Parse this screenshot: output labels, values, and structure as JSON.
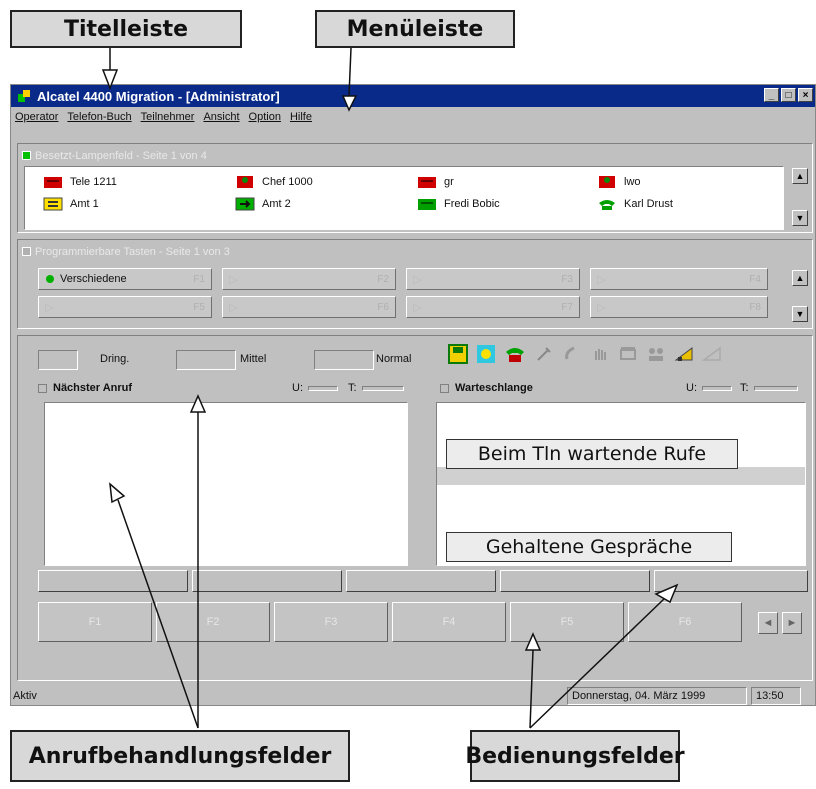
{
  "callouts": {
    "titlebar": "Titelleiste",
    "menubar": "Menüleiste",
    "call_fields": "Anrufbehandlungsfelder",
    "operator_fields": "Bedienungsfelder",
    "waiting_calls": "Beim Tln wartende Rufe",
    "held_calls": "Gehaltene Gespräche"
  },
  "window": {
    "title": "Alcatel 4400 Migration - [Administrator]",
    "buttons": [
      "_",
      "□",
      "×"
    ]
  },
  "menu": [
    "Operator",
    "Telefon-Buch",
    "Teilnehmer",
    "Ansicht",
    "Option",
    "Hilfe"
  ],
  "busy_lamp": {
    "header": "Besetzt-Lampenfeld - Seite 1 von 4",
    "parties": [
      {
        "label": "Tele 1211",
        "icon": "red-phone-icon"
      },
      {
        "label": "Chef 1000",
        "icon": "red-phone-person-icon"
      },
      {
        "label": "gr",
        "icon": "red-phone-icon"
      },
      {
        "label": "lwo",
        "icon": "red-phone-person-icon"
      },
      {
        "label": "Amt 1",
        "icon": "yellow-trunk-icon"
      },
      {
        "label": "Amt 2",
        "icon": "green-trunk-icon"
      },
      {
        "label": "Fredi Bobic",
        "icon": "green-phone-icon"
      },
      {
        "label": "Karl Drust",
        "icon": "green-handset-icon"
      }
    ]
  },
  "prog_keys": {
    "header": "Programmierbare Tasten - Seite 1 von 3",
    "keys": [
      {
        "label": "Verschiedene",
        "num": "F1"
      },
      {
        "label": "",
        "num": "F2"
      },
      {
        "label": "",
        "num": "F3"
      },
      {
        "label": "",
        "num": "F4"
      },
      {
        "label": "",
        "num": "F5"
      },
      {
        "label": "",
        "num": "F6"
      },
      {
        "label": "",
        "num": "F7"
      },
      {
        "label": "",
        "num": "F8"
      }
    ]
  },
  "priority": {
    "dring": "Dring.",
    "mittel": "Mittel",
    "normal": "Normal"
  },
  "next_call": {
    "title": "Nächster Anruf",
    "u": "U:",
    "t": "T:"
  },
  "queue": {
    "title": "Warteschlange",
    "u": "U:",
    "t": "T:"
  },
  "fkeys": [
    "F1",
    "F2",
    "F3",
    "F4",
    "F5",
    "F6"
  ],
  "fnav": [
    "◄",
    "►"
  ],
  "status": {
    "state": "Aktiv",
    "date": "Donnerstag, 04. März 1999",
    "time": "13:50"
  },
  "colors": {
    "titlebar": "#0a2a8a",
    "window": "#c0c0c0"
  }
}
